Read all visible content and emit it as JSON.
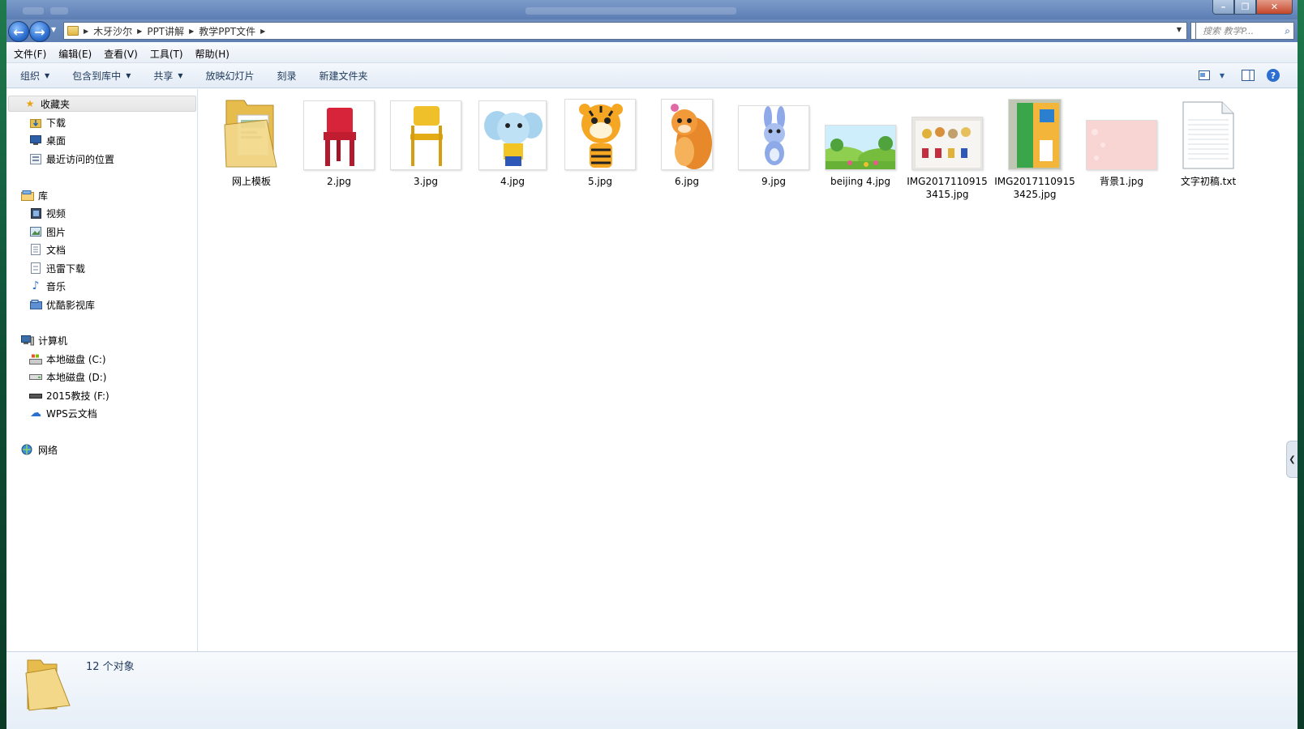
{
  "window": {
    "title_glyphs": "",
    "controls": {
      "minimize": "–",
      "maximize": "❐",
      "close": "✕"
    }
  },
  "address": {
    "breadcrumbs": [
      "木牙沙尔",
      "PPT讲解",
      "教学PPT文件"
    ],
    "search_placeholder": "搜索 教学P..."
  },
  "menubar": [
    "文件(F)",
    "编辑(E)",
    "查看(V)",
    "工具(T)",
    "帮助(H)"
  ],
  "toolbar": {
    "organize": "组织",
    "include_in_library": "包含到库中",
    "share": "共享",
    "slideshow": "放映幻灯片",
    "burn": "刻录",
    "new_folder": "新建文件夹"
  },
  "sidebar": {
    "favorites": {
      "label": "收藏夹",
      "items": [
        "下载",
        "桌面",
        "最近访问的位置"
      ]
    },
    "libraries": {
      "label": "库",
      "items": [
        "视频",
        "图片",
        "文档",
        "迅雷下载",
        "音乐",
        "优酷影视库"
      ]
    },
    "computer": {
      "label": "计算机",
      "items": [
        "本地磁盘 (C:)",
        "本地磁盘 (D:)",
        "2015教技 (F:)",
        "WPS云文档"
      ]
    },
    "network": {
      "label": "网络"
    }
  },
  "files": [
    {
      "name": "网上模板",
      "type": "folder"
    },
    {
      "name": "2.jpg",
      "type": "image",
      "subject": "red-chair"
    },
    {
      "name": "3.jpg",
      "type": "image",
      "subject": "yellow-chair"
    },
    {
      "name": "4.jpg",
      "type": "image",
      "subject": "elephant"
    },
    {
      "name": "5.jpg",
      "type": "image",
      "subject": "tiger"
    },
    {
      "name": "6.jpg",
      "type": "image",
      "subject": "squirrel"
    },
    {
      "name": "9.jpg",
      "type": "image",
      "subject": "rabbit"
    },
    {
      "name": "beijing 4.jpg",
      "type": "image",
      "subject": "landscape"
    },
    {
      "name": "IMG20171109153415.jpg",
      "type": "image",
      "subject": "photo-cards"
    },
    {
      "name": "IMG20171109153425.jpg",
      "type": "image",
      "subject": "photo-book"
    },
    {
      "name": "背景1.jpg",
      "type": "image",
      "subject": "pink-background"
    },
    {
      "name": "文字初稿.txt",
      "type": "text"
    }
  ],
  "status": {
    "count_text": "12 个对象"
  },
  "colors": {
    "accent": "#2d6fd0",
    "titlebar": "#6788bc",
    "folder": "#e9bf4b"
  }
}
